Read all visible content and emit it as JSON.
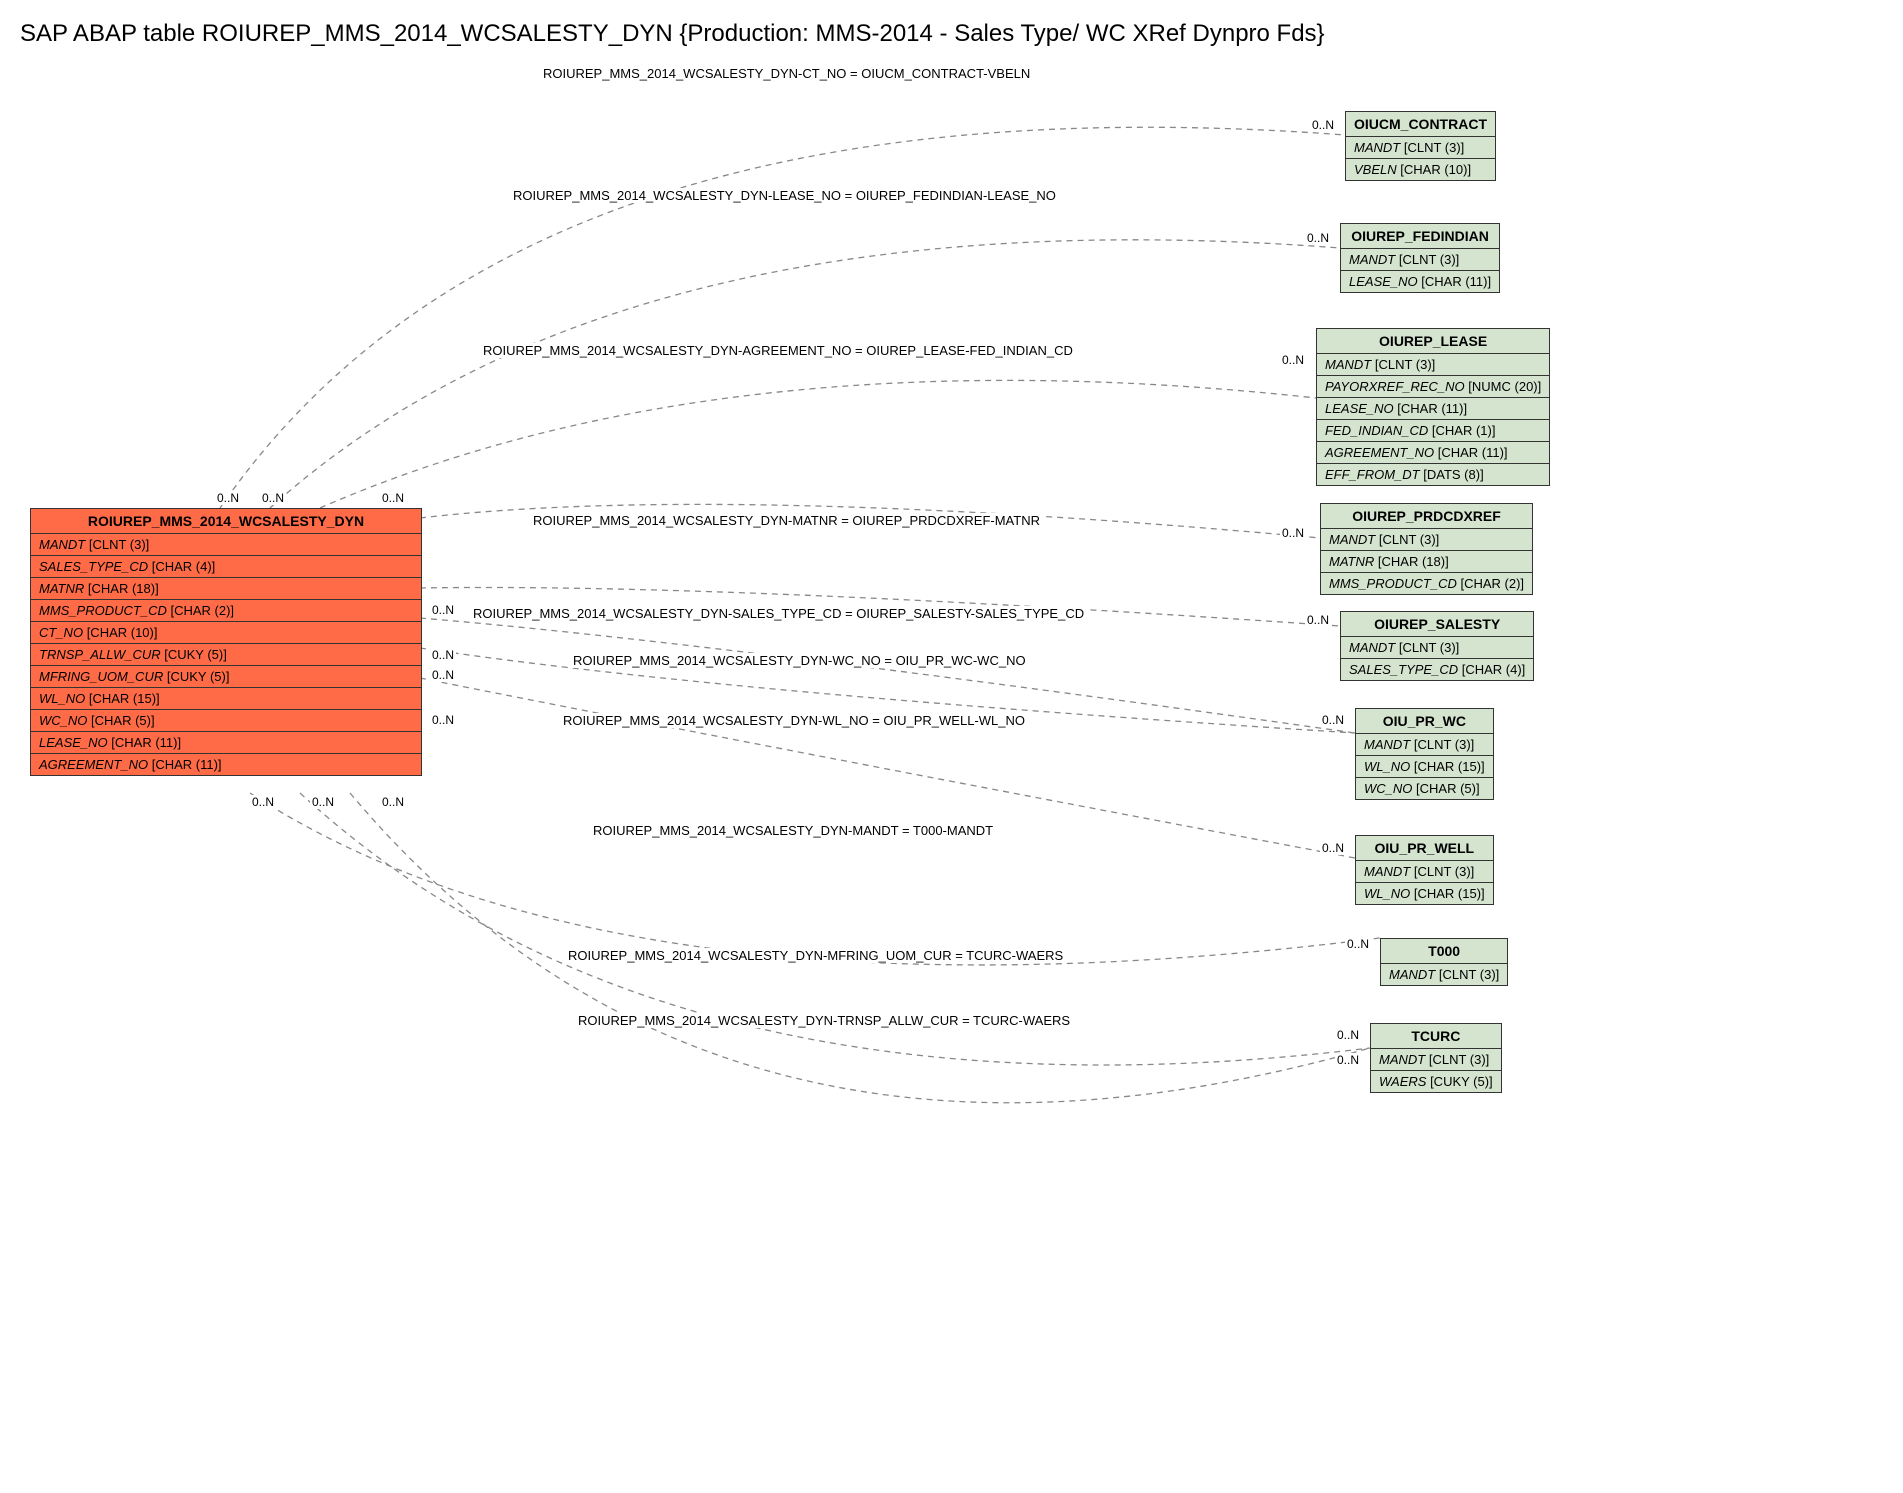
{
  "title": "SAP ABAP table ROIUREP_MMS_2014_WCSALESTY_DYN {Production:  MMS-2014 - Sales Type/ WC XRef Dynpro Fds}",
  "main_entity": {
    "name": "ROIUREP_MMS_2014_WCSALESTY_DYN",
    "fields": [
      {
        "name": "MANDT",
        "type": "[CLNT (3)]"
      },
      {
        "name": "SALES_TYPE_CD",
        "type": "[CHAR (4)]"
      },
      {
        "name": "MATNR",
        "type": "[CHAR (18)]"
      },
      {
        "name": "MMS_PRODUCT_CD",
        "type": "[CHAR (2)]"
      },
      {
        "name": "CT_NO",
        "type": "[CHAR (10)]"
      },
      {
        "name": "TRNSP_ALLW_CUR",
        "type": "[CUKY (5)]"
      },
      {
        "name": "MFRING_UOM_CUR",
        "type": "[CUKY (5)]"
      },
      {
        "name": "WL_NO",
        "type": "[CHAR (15)]"
      },
      {
        "name": "WC_NO",
        "type": "[CHAR (5)]"
      },
      {
        "name": "LEASE_NO",
        "type": "[CHAR (11)]"
      },
      {
        "name": "AGREEMENT_NO",
        "type": "[CHAR (11)]"
      }
    ]
  },
  "ref_entities": [
    {
      "id": 0,
      "name": "OIUCM_CONTRACT",
      "fields": [
        {
          "name": "MANDT",
          "type": "[CLNT (3)]"
        },
        {
          "name": "VBELN",
          "type": "[CHAR (10)]"
        }
      ]
    },
    {
      "id": 1,
      "name": "OIUREP_FEDINDIAN",
      "fields": [
        {
          "name": "MANDT",
          "type": "[CLNT (3)]"
        },
        {
          "name": "LEASE_NO",
          "type": "[CHAR (11)]"
        }
      ]
    },
    {
      "id": 2,
      "name": "OIUREP_LEASE",
      "fields": [
        {
          "name": "MANDT",
          "type": "[CLNT (3)]"
        },
        {
          "name": "PAYORXREF_REC_NO",
          "type": "[NUMC (20)]"
        },
        {
          "name": "LEASE_NO",
          "type": "[CHAR (11)]"
        },
        {
          "name": "FED_INDIAN_CD",
          "type": "[CHAR (1)]"
        },
        {
          "name": "AGREEMENT_NO",
          "type": "[CHAR (11)]"
        },
        {
          "name": "EFF_FROM_DT",
          "type": "[DATS (8)]"
        }
      ]
    },
    {
      "id": 3,
      "name": "OIUREP_PRDCDXREF",
      "fields": [
        {
          "name": "MANDT",
          "type": "[CLNT (3)]"
        },
        {
          "name": "MATNR",
          "type": "[CHAR (18)]"
        },
        {
          "name": "MMS_PRODUCT_CD",
          "type": "[CHAR (2)]"
        }
      ]
    },
    {
      "id": 4,
      "name": "OIUREP_SALESTY",
      "fields": [
        {
          "name": "MANDT",
          "type": "[CLNT (3)]"
        },
        {
          "name": "SALES_TYPE_CD",
          "type": "[CHAR (4)]"
        }
      ]
    },
    {
      "id": 5,
      "name": "OIU_PR_WC",
      "fields": [
        {
          "name": "MANDT",
          "type": "[CLNT (3)]"
        },
        {
          "name": "WL_NO",
          "type": "[CHAR (15)]"
        },
        {
          "name": "WC_NO",
          "type": "[CHAR (5)]"
        }
      ]
    },
    {
      "id": 6,
      "name": "OIU_PR_WELL",
      "fields": [
        {
          "name": "MANDT",
          "type": "[CLNT (3)]"
        },
        {
          "name": "WL_NO",
          "type": "[CHAR (15)]"
        }
      ]
    },
    {
      "id": 7,
      "name": "T000",
      "fields": [
        {
          "name": "MANDT",
          "type": "[CLNT (3)]"
        }
      ]
    },
    {
      "id": 8,
      "name": "TCURC",
      "fields": [
        {
          "name": "MANDT",
          "type": "[CLNT (3)]"
        },
        {
          "name": "WAERS",
          "type": "[CUKY (5)]"
        }
      ]
    }
  ],
  "relations": [
    {
      "label": "ROIUREP_MMS_2014_WCSALESTY_DYN-CT_NO = OIUCM_CONTRACT-VBELN"
    },
    {
      "label": "ROIUREP_MMS_2014_WCSALESTY_DYN-LEASE_NO = OIUREP_FEDINDIAN-LEASE_NO"
    },
    {
      "label": "ROIUREP_MMS_2014_WCSALESTY_DYN-AGREEMENT_NO = OIUREP_LEASE-FED_INDIAN_CD"
    },
    {
      "label": "ROIUREP_MMS_2014_WCSALESTY_DYN-MATNR = OIUREP_PRDCDXREF-MATNR"
    },
    {
      "label": "ROIUREP_MMS_2014_WCSALESTY_DYN-SALES_TYPE_CD = OIUREP_SALESTY-SALES_TYPE_CD"
    },
    {
      "label": "ROIUREP_MMS_2014_WCSALESTY_DYN-WC_NO = OIU_PR_WC-WC_NO"
    },
    {
      "label": "ROIUREP_MMS_2014_WCSALESTY_DYN-WL_NO = OIU_PR_WELL-WL_NO"
    },
    {
      "label": "ROIUREP_MMS_2014_WCSALESTY_DYN-MANDT = T000-MANDT"
    },
    {
      "label": "ROIUREP_MMS_2014_WCSALESTY_DYN-MFRING_UOM_CUR = TCURC-WAERS"
    },
    {
      "label": "ROIUREP_MMS_2014_WCSALESTY_DYN-TRNSP_ALLW_CUR = TCURC-WAERS"
    }
  ],
  "cardinality": "0..N"
}
